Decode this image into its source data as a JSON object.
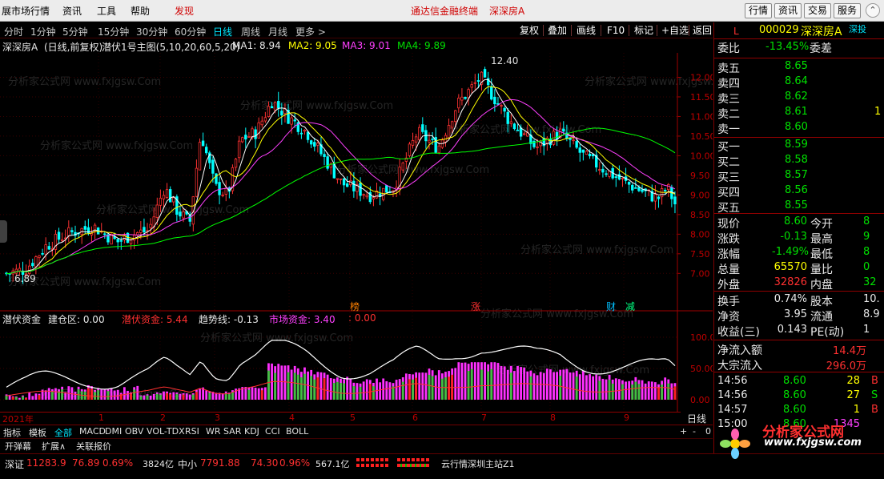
{
  "menu": {
    "items": [
      "展市场行情",
      "资讯",
      "工具",
      "帮助",
      "发现"
    ],
    "title_left": "通达信金融终端",
    "title_right": "深深房A",
    "buttons": [
      "行情",
      "资讯",
      "交易",
      "服务"
    ]
  },
  "toolbar": {
    "timeframes": [
      "分时",
      "1分钟",
      "5分钟",
      "15分钟",
      "30分钟",
      "60分钟",
      "日线",
      "周线",
      "月线",
      "更多 >"
    ],
    "buttons": [
      "复权",
      "叠加",
      "画线",
      "F10",
      "标记",
      "+自选",
      "返回"
    ]
  },
  "main_header": {
    "name": "深深房A",
    "mode": "(日线,前复权)",
    "indicator": "潜伏1号主图(5,10,20,60,5,20)",
    "ma1": "MA1: 8.94",
    "ma2": "MA2: 9.05",
    "ma3": "MA3: 9.01",
    "ma4": "MA4: 9.89"
  },
  "ind_header": {
    "name": "潜伏资金",
    "jcq": "建仓区: 0.00",
    "qfzj": "潜伏资金: 5.44",
    "qsx": "趋势线: -0.13",
    "sczj": "市场资金: 3.40",
    "last": ": 0.00"
  },
  "date_axis": [
    "2021年",
    "1",
    "2",
    "3",
    "4",
    "5",
    "6",
    "7",
    "8",
    "9"
  ],
  "period_label": "日线",
  "tabs": [
    "指标",
    "模板",
    "全部",
    "MACD",
    "DMI",
    "OBV",
    "VOL-TDX",
    "RSI",
    "WR",
    "SAR",
    "KDJ",
    "CCI",
    "BOLL"
  ],
  "tabs2": [
    "开弹幕",
    "扩展∧",
    "关联报价"
  ],
  "watermark": "分析家公式网 www.fxjgsw.Com",
  "status": {
    "sz_label": "深证",
    "sz_val": "11283.9",
    "sz_chg": "76.89",
    "sz_pct": "0.69%",
    "sz_amt": "3824亿",
    "zx_label": "中小",
    "zx_val": "7791.88",
    "zx_chg": "74.30",
    "zx_pct": "0.96%",
    "zx_amt": "567.1亿",
    "server": "云行情深圳主站Z1"
  },
  "side": {
    "l_badge": "L",
    "code": "000029",
    "name": "深深房A",
    "tag": "深投",
    "weibi_label": "委比",
    "weibi": "-13.45%",
    "weicha_label": "委差",
    "asks": [
      {
        "label": "卖五",
        "price": "8.65"
      },
      {
        "label": "卖四",
        "price": "8.64"
      },
      {
        "label": "卖三",
        "price": "8.62"
      },
      {
        "label": "卖二",
        "price": "8.61",
        "vol": "1"
      },
      {
        "label": "卖一",
        "price": "8.60"
      }
    ],
    "bids": [
      {
        "label": "买一",
        "price": "8.59"
      },
      {
        "label": "买二",
        "price": "8.58"
      },
      {
        "label": "买三",
        "price": "8.57"
      },
      {
        "label": "买四",
        "price": "8.56"
      },
      {
        "label": "买五",
        "price": "8.55"
      }
    ],
    "stats": [
      {
        "l": "现价",
        "v": "8.60",
        "l2": "今开",
        "v2": "8"
      },
      {
        "l": "涨跌",
        "v": "-0.13",
        "l2": "最高",
        "v2": "9"
      },
      {
        "l": "涨幅",
        "v": "-1.49%",
        "l2": "最低",
        "v2": "8"
      },
      {
        "l": "总量",
        "v": "65570",
        "l2": "量比",
        "v2": "0"
      },
      {
        "l": "外盘",
        "v": "32826",
        "l2": "内盘",
        "v2": "32"
      }
    ],
    "stats2": [
      {
        "l": "换手",
        "v": "0.74%",
        "l2": "股本",
        "v2": "10."
      },
      {
        "l": "净资",
        "v": "3.95",
        "l2": "流通",
        "v2": "8.9"
      },
      {
        "l": "收益(三)",
        "v": "0.143",
        "l2": "PE(动)",
        "v2": "1"
      }
    ],
    "flow": [
      {
        "l": "净流入额",
        "v": "14.4万"
      },
      {
        "l": "大宗流入",
        "v": "296.0万"
      }
    ],
    "ticks": [
      {
        "t": "14:56",
        "p": "8.60",
        "v": "28",
        "d": "B"
      },
      {
        "t": "14:56",
        "p": "8.60",
        "v": "27",
        "d": "S"
      },
      {
        "t": "14:57",
        "p": "8.60",
        "v": "1",
        "d": "B"
      },
      {
        "t": "15:00",
        "p": "8.60",
        "v": "1345",
        "d": ""
      }
    ],
    "logo_text": "分析家公式网",
    "logo_url": "www.fxjgsw.com"
  },
  "chart_data": {
    "type": "candlestick",
    "price_axis": [
      "12.00",
      "11.50",
      "11.00",
      "10.50",
      "10.00",
      "9.50",
      "9.00",
      "8.50",
      "8.00",
      "7.50",
      "7.00"
    ],
    "ylim": [
      6.7,
      12.5
    ],
    "high_label": "12.40",
    "low_label": "6.89",
    "events": [
      "榜",
      "涨",
      "财",
      "减"
    ],
    "ind_axis": [
      "100.00",
      "50.00",
      "0.00"
    ]
  }
}
